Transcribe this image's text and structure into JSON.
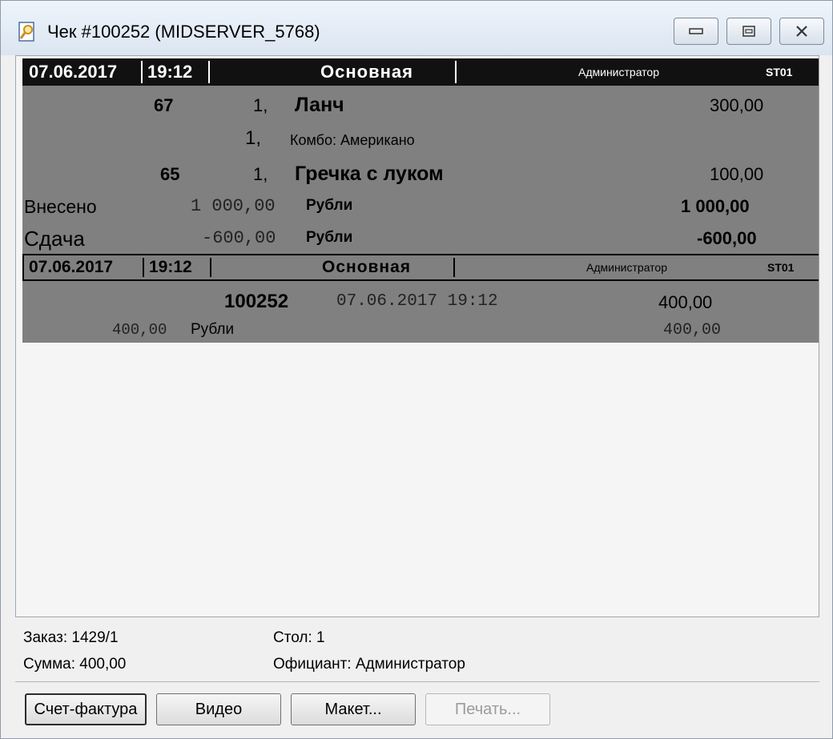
{
  "window": {
    "title": "Чек #100252 (MIDSERVER_5768)",
    "minimize_icon": "minimize-icon",
    "maximize_icon": "maximize-icon",
    "close_icon": "close-icon"
  },
  "receipt": {
    "header1": {
      "date": "07.06.2017",
      "time": "19:12",
      "section": "Основная",
      "user": "Администратор",
      "station": "ST01"
    },
    "items": [
      {
        "code": "67",
        "qty": "1,",
        "name": "Ланч",
        "price": "300,00"
      },
      {
        "qty": "1,",
        "name": "Комбо: Американо"
      },
      {
        "code": "65",
        "qty": "1,",
        "name": "Гречка с луком",
        "price": "100,00"
      }
    ],
    "paid": {
      "label": "Внесено",
      "amount": "1 000,00",
      "currency": "Рубли",
      "total": "1 000,00"
    },
    "change": {
      "label": "Сдача",
      "amount": "-600,00",
      "currency": "Рубли",
      "total": "-600,00"
    },
    "header2": {
      "date": "07.06.2017",
      "time": "19:12",
      "section": "Основная",
      "user": "Администратор",
      "station": "ST01"
    },
    "check": {
      "number": "100252",
      "datetime": "07.06.2017 19:12",
      "sum": "400,00"
    },
    "payment": {
      "amount": "400,00",
      "currency": "Рубли",
      "total": "400,00"
    }
  },
  "info": {
    "order": "Заказ: 1429/1",
    "sum": "Сумма: 400,00",
    "table": "Стол: 1",
    "waiter": "Официант: Администратор"
  },
  "buttons": {
    "invoice": "Счет-фактура",
    "video": "Видео",
    "layout": "Макет...",
    "print": "Печать..."
  }
}
